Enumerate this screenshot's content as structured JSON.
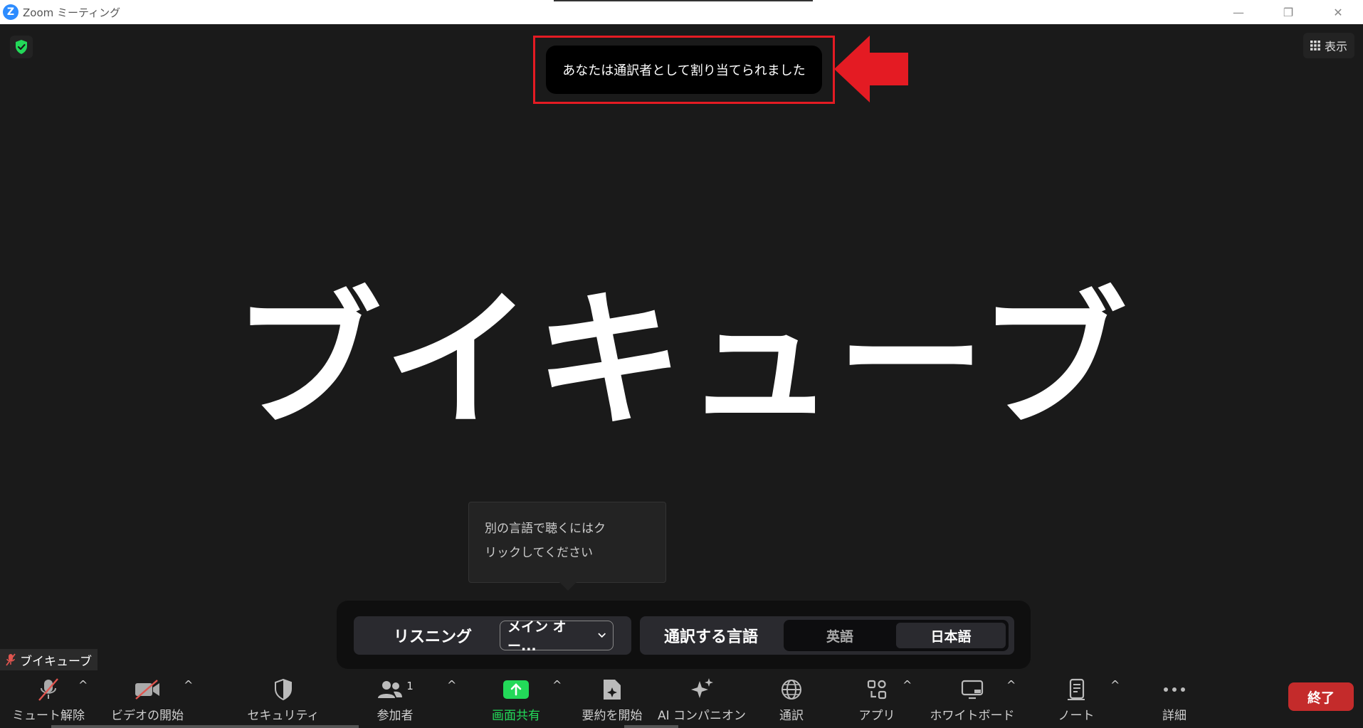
{
  "window": {
    "logo_letter": "Z",
    "title": "Zoom ミーティング",
    "minimize": "—",
    "restore": "❐",
    "close": "✕"
  },
  "header": {
    "view_label": "表示"
  },
  "notice": {
    "text": "あなたは通訳者として割り当てられました"
  },
  "participant": {
    "display_name": "ブイキューブ",
    "name_tag": "ブイキューブ"
  },
  "tooltip": {
    "line1": "別の言語で聴くにはク",
    "line2": "リックしてください"
  },
  "interpretation": {
    "listening_label": "リスニング",
    "listening_value": "メイン オー...",
    "interpret_label": "通訳する言語",
    "languages": [
      "英語",
      "日本語"
    ],
    "selected_language": "日本語"
  },
  "toolbar": {
    "mute": "ミュート解除",
    "video": "ビデオの開始",
    "security": "セキュリティ",
    "participants": "参加者",
    "participant_count": "1",
    "share": "画面共有",
    "summary": "要約を開始",
    "ai": "AI コンパニオン",
    "interpretation": "通訳",
    "apps": "アプリ",
    "whiteboard": "ホワイトボード",
    "notes": "ノート",
    "more": "詳細",
    "end": "終了"
  },
  "colors": {
    "accent_red": "#e41b23",
    "share_green": "#23d959",
    "end_red": "#c42b2b",
    "zoom_blue": "#2d8cff"
  }
}
